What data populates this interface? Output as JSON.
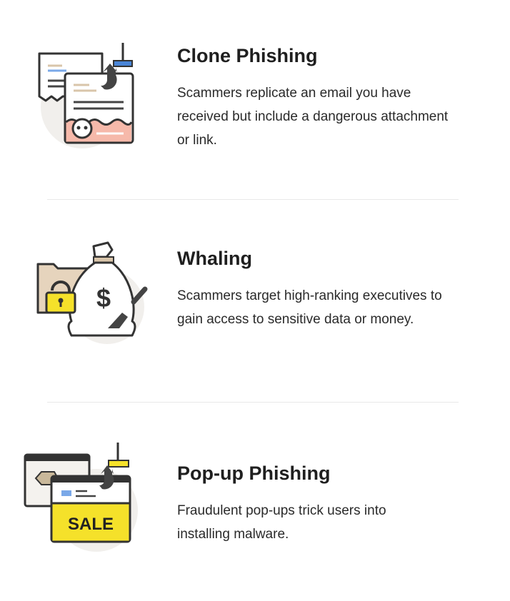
{
  "items": [
    {
      "icon": "clone-phishing-icon",
      "title": "Clone Phishing",
      "description": "Scammers replicate an email you have received but include a dangerous attachment or link."
    },
    {
      "icon": "whaling-icon",
      "title": "Whaling",
      "description": "Scammers target high-ranking executives to gain access to sensitive data or money."
    },
    {
      "icon": "popup-phishing-icon",
      "title": "Pop-up Phishing",
      "description": "Fraudulent pop-ups trick users into installing malware.",
      "icon_text": "SALE"
    }
  ],
  "colors": {
    "outline": "#333333",
    "accent_yellow": "#f5e12a",
    "accent_blue": "#4a86d8",
    "accent_pink": "#f6b9aa",
    "accent_tan": "#e6d4bd",
    "circle_bg": "#f1efec"
  }
}
